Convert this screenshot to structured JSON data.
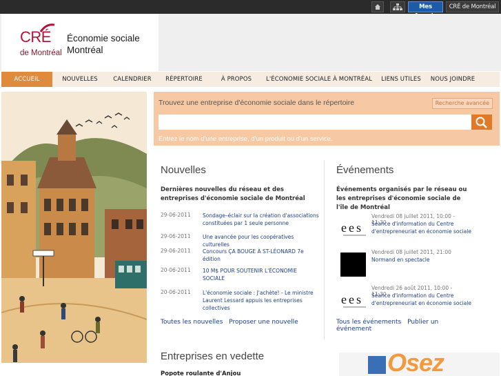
{
  "topbar": {
    "home_icon": "home-icon",
    "sitemap_icon": "sitemap-icon",
    "favorites_label": "Mes favoris",
    "cre_label": "CRÉ de Montréal"
  },
  "header": {
    "logo_cre": "CRÉ",
    "logo_montreal": "de Montréal",
    "site_title_line1": "Économie sociale",
    "site_title_line2": "Montréal"
  },
  "nav": {
    "items": [
      {
        "label": "ACCUEIL"
      },
      {
        "label": "NOUVELLES"
      },
      {
        "label": "CALENDRIER"
      },
      {
        "label": "RÉPERTOIRE"
      },
      {
        "label": "À PROPOS"
      },
      {
        "label": "L'ÉCONOMIE SOCIALE À MONTRÉAL"
      },
      {
        "label": "LIENS UTILES"
      },
      {
        "label": "NOUS JOINDRE"
      }
    ]
  },
  "search": {
    "title": "Trouvez une entreprise d'économie sociale dans le répertoire",
    "advanced_label": "Recherche avancée",
    "value": "",
    "hint": "Entrez le nom d'une entreprise, d'un produit ou d'un service."
  },
  "news": {
    "heading": "Nouvelles",
    "subtitle": "Dernières nouvelles du réseau et des entreprises d'économie sociale de Montréal",
    "items": [
      {
        "date": "29-06-2011",
        "title": "Sondage–éclair sur la création d'associations constituées par 1 seule personne"
      },
      {
        "date": "29-06-2011",
        "title": "Une avancée pour les coopératives culturelles"
      },
      {
        "date": "29-06-2011",
        "title": "Concours ÇA BOUGE À ST-LÉONARD 7e édition"
      },
      {
        "date": "20-06-2011",
        "title": "10 M$ POUR SOUTENIR L'ÉCONOMIE SOCIALE"
      },
      {
        "date": "20-06-2011",
        "title": "L'économie sociale : J'achète! - Le ministre Laurent Lessard appuis les entreprises collectives"
      }
    ],
    "all_label": "Toutes les nouvelles",
    "propose_label": "Proposer une nouvelle"
  },
  "events": {
    "heading": "Événements",
    "subtitle": "Événements organisés par le réseau ou les entreprises d'économie sociale de l'île de Montréal",
    "items": [
      {
        "date": "Vendredi 08 juillet 2011, 10:00 - 11:30",
        "title": "Séance d'information du Centre d'entrepreneuriat en économie sociale",
        "thumb_text": "ees"
      },
      {
        "date": "Vendredi 08 juillet 2011, 21:00",
        "title": "Normand en spectacle",
        "thumb_text": ""
      },
      {
        "date": "Vendredi 26 août 2011, 10:00 - 11:30",
        "title": "Séance d'information du Centre d'entrepreneuriat en économie sociale",
        "thumb_text": "ees"
      }
    ],
    "all_label": "Tous les événements",
    "publish_label": "Publier un événement"
  },
  "vedette": {
    "heading": "Entreprises en vedette",
    "first_item": "Popote roulante d'Anjou"
  },
  "promo": {
    "text": "Osez"
  },
  "colors": {
    "accent_orange": "#e08a3c",
    "search_bg": "#f6c9a4",
    "link_blue": "#1d3f8a",
    "brand_red": "#b6123a"
  }
}
